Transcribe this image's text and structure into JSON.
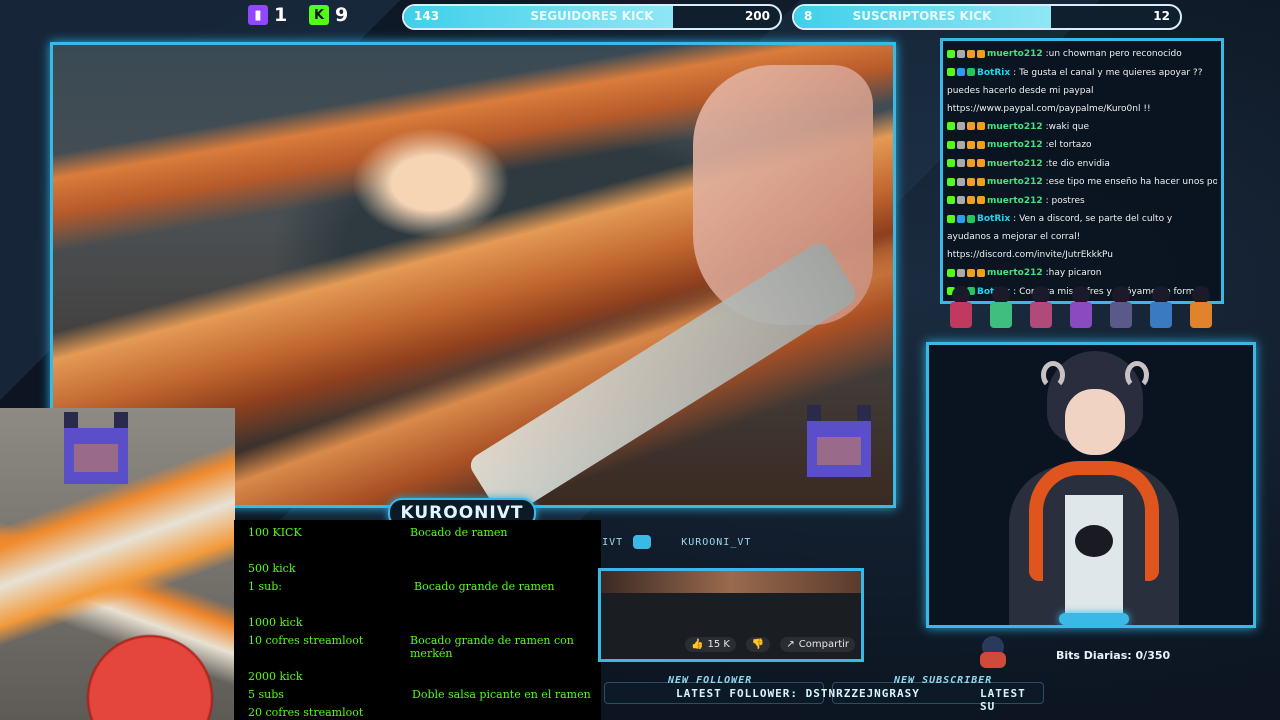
{
  "topbar": {
    "twitch_count": "1",
    "kick_count": "9",
    "followers_goal": {
      "current": "143",
      "label": "SEGUIDORES KICK",
      "target": "200",
      "progress": 0.715
    },
    "subs_goal": {
      "current": "8",
      "label": "SUSCRIPTORES KICK",
      "target": "12",
      "progress": 0.667
    }
  },
  "stream": {
    "channel_name": "KUROONIVT",
    "social_kick": "KUROONIVT",
    "social_youtube": "KUROONI_VT"
  },
  "chat": {
    "messages": [
      {
        "user": "muerto212",
        "text": ":un chowman pero reconocido",
        "bot": false
      },
      {
        "user": "BotRix",
        "text": ": Te gusta el canal y me quieres apoyar ?? puedes hacerlo desde mi paypal https://www.paypal.com/paypalme/Kuro0nl !!",
        "bot": true
      },
      {
        "user": "muerto212",
        "text": ":waki que",
        "bot": false
      },
      {
        "user": "muerto212",
        "text": ":el tortazo",
        "bot": false
      },
      {
        "user": "muerto212",
        "text": ":te dio envidia",
        "bot": false
      },
      {
        "user": "muerto212",
        "text": ":ese tipo me enseño ha hacer unos posters",
        "bot": false
      },
      {
        "user": "muerto212",
        "text": ": postres",
        "bot": false
      },
      {
        "user": "BotRix",
        "text": ": Ven a discord, se parte del culto y ayudanos a mejorar el corral! https://discord.com/invite/JutrEkkkPu",
        "bot": true
      },
      {
        "user": "muerto212",
        "text": ":hay picaron",
        "bot": false
      },
      {
        "user": "BotRix",
        "text": ": Compra mis cofres y apóyame de forma más económica en https://www.streamloots.com/kuroonivt",
        "bot": true
      }
    ]
  },
  "rewards": {
    "rows": [
      {
        "req": "100 KICK",
        "reward": "Bocado de ramen"
      },
      {
        "req": "500 kick",
        "reward": ""
      },
      {
        "req": "1 sub:",
        "reward": "Bocado grande de ramen"
      },
      {
        "req": "1000 kick",
        "reward": ""
      },
      {
        "req": "10 cofres streamloot",
        "reward": "Bocado grande de ramen con merkén"
      },
      {
        "req": "2000 kick",
        "reward": ""
      },
      {
        "req": "5 subs",
        "reward": "Doble salsa picante en el ramen"
      },
      {
        "req": "20 cofres streamloot",
        "reward": ""
      }
    ]
  },
  "preview": {
    "likes": "15 K",
    "share_label": "Compartir"
  },
  "bottom": {
    "new_follower_label": "NEW FOLLOWER",
    "latest_follower": "LATEST FOLLOWER: DSTNRZZEJNGRASY",
    "new_subscriber_label": "NEW SUBSCRIBER",
    "latest_sub": "LATEST SU"
  },
  "bits": {
    "label": "Bits Diarias:",
    "value": "0/350"
  },
  "colors": {
    "accent": "#3ab9e6",
    "kick_green": "#53fc18",
    "twitch_purple": "#9146ff"
  }
}
